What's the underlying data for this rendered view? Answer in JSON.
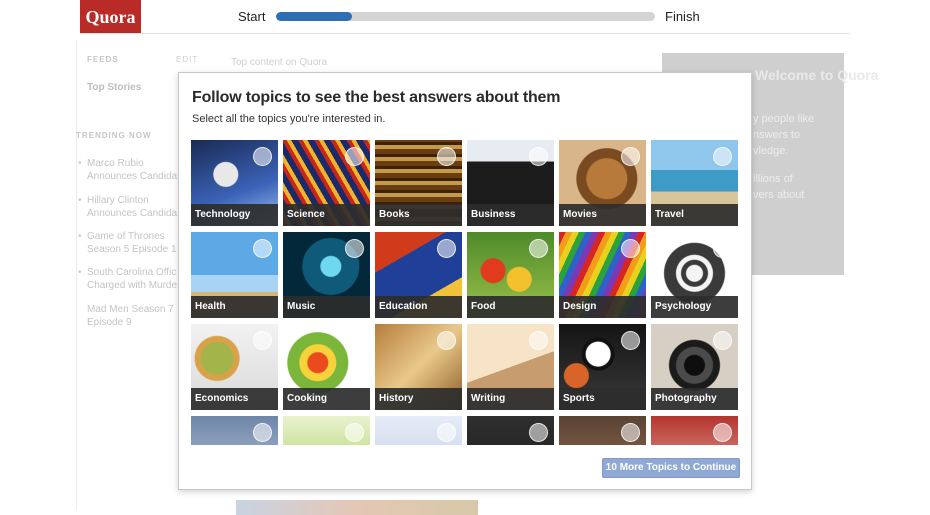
{
  "header": {
    "logo": "Quora",
    "progress_start": "Start",
    "progress_end": "Finish",
    "progress_fraction": 0.2
  },
  "background": {
    "feeds": "FEEDS",
    "edit": "EDIT",
    "top_content": "Top content on Quora",
    "top_stories": "Top Stories",
    "trending": "TRENDING NOW",
    "trending_items": [
      "Marco Rubio Announces Candida",
      "Hillary Clinton Announces Candida",
      "Game of Thrones Season 5 Episode 1",
      "South Carolina Offic Charged with Murde"
    ],
    "trending_extra": "Mad Men Season 7 Episode 9",
    "welcome": "Welcome to Quora",
    "right_lines": [
      "y people like",
      "nswers to",
      "vledge.",
      "illions of",
      "vers about"
    ]
  },
  "modal": {
    "title": "Follow topics to see the best answers about them",
    "subtitle": "Select all the topics you're interested in.",
    "continue_label": "10 More Topics to Continue",
    "topics": [
      {
        "label": "Technology",
        "icon": "astronaut-image"
      },
      {
        "label": "Science",
        "icon": "dna-image"
      },
      {
        "label": "Books",
        "icon": "books-image"
      },
      {
        "label": "Business",
        "icon": "businesspeople-image"
      },
      {
        "label": "Movies",
        "icon": "film-reel-image"
      },
      {
        "label": "Travel",
        "icon": "beach-resort-image"
      },
      {
        "label": "Health",
        "icon": "yoga-image"
      },
      {
        "label": "Music",
        "icon": "microphone-image"
      },
      {
        "label": "Education",
        "icon": "graduation-cap-image"
      },
      {
        "label": "Food",
        "icon": "vegetables-image"
      },
      {
        "label": "Design",
        "icon": "colored-pencils-image"
      },
      {
        "label": "Psychology",
        "icon": "head-brain-image"
      },
      {
        "label": "Economics",
        "icon": "coins-image"
      },
      {
        "label": "Cooking",
        "icon": "salad-image"
      },
      {
        "label": "History",
        "icon": "old-map-image"
      },
      {
        "label": "Writing",
        "icon": "pen-writing-image"
      },
      {
        "label": "Sports",
        "icon": "balls-image"
      },
      {
        "label": "Photography",
        "icon": "camera-image"
      },
      {
        "label": "",
        "icon": "partial-image"
      },
      {
        "label": "",
        "icon": "partial-image"
      },
      {
        "label": "",
        "icon": "partial-image"
      },
      {
        "label": "",
        "icon": "partial-image"
      },
      {
        "label": "",
        "icon": "partial-image"
      },
      {
        "label": "",
        "icon": "partial-image"
      }
    ]
  },
  "colors": {
    "brand": "#b92b27",
    "progress": "#2f6db4",
    "button": "#90a8d4"
  }
}
